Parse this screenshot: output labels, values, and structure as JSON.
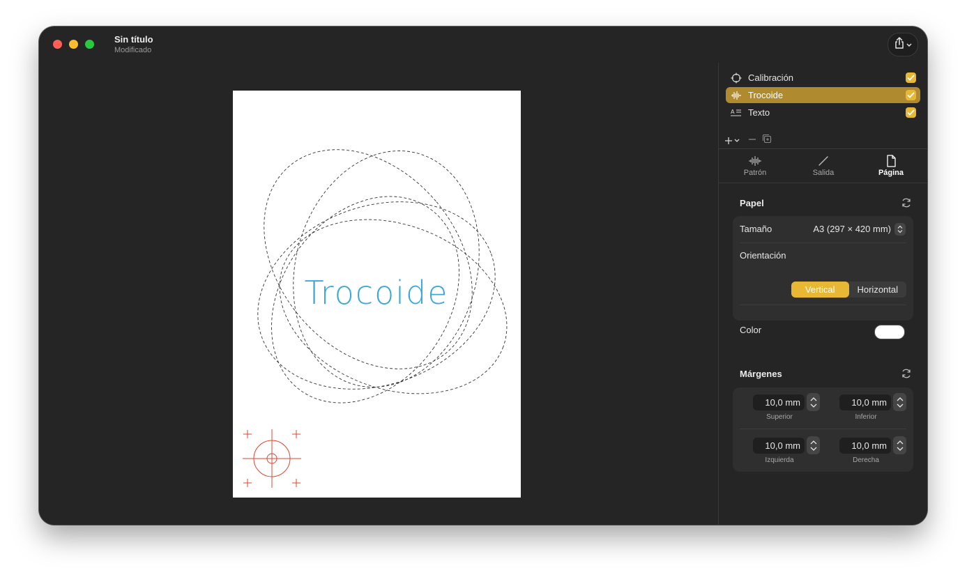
{
  "window": {
    "title": "Sin título",
    "subtitle": "Modificado"
  },
  "canvas": {
    "paper_text": "Trocoide",
    "paper_text_color": "#39a9dc",
    "calibration_color": "#e2442b"
  },
  "layers": [
    {
      "label": "Calibración",
      "icon": "crosshair-icon",
      "checked": true,
      "selected": false
    },
    {
      "label": "Trocoide",
      "icon": "waveform-icon",
      "checked": true,
      "selected": true
    },
    {
      "label": "Texto",
      "icon": "text-format-icon",
      "checked": true,
      "selected": false
    }
  ],
  "tabs": [
    {
      "label": "Patrón",
      "icon": "waveform-icon",
      "active": false
    },
    {
      "label": "Salida",
      "icon": "pen-line-icon",
      "active": false
    },
    {
      "label": "Página",
      "icon": "page-icon",
      "active": true
    }
  ],
  "paper_section": {
    "title": "Papel",
    "size_label": "Tamaño",
    "size_value": "A3 (297 × 420 mm)",
    "orientation_label": "Orientación",
    "orientation_options": [
      "Vertical",
      "Horizontal"
    ],
    "orientation_selected": "Vertical",
    "color_label": "Color",
    "paper_color": "#ffffff"
  },
  "margins_section": {
    "title": "Márgenes",
    "fields": [
      {
        "value": "10,0 mm",
        "caption": "Superior"
      },
      {
        "value": "10,0 mm",
        "caption": "Inferior"
      },
      {
        "value": "10,0 mm",
        "caption": "Izquierda"
      },
      {
        "value": "10,0 mm",
        "caption": "Derecha"
      }
    ]
  },
  "colors": {
    "accent": "#e8b733",
    "selection": "#b08a2e",
    "window_bg": "#252525"
  }
}
